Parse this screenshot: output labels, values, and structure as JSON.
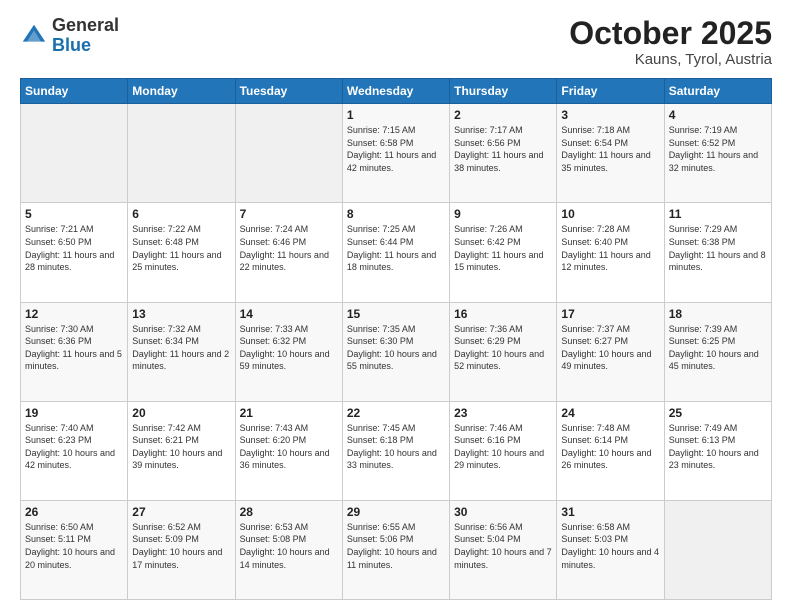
{
  "header": {
    "logo_general": "General",
    "logo_blue": "Blue",
    "month": "October 2025",
    "location": "Kauns, Tyrol, Austria"
  },
  "weekdays": [
    "Sunday",
    "Monday",
    "Tuesday",
    "Wednesday",
    "Thursday",
    "Friday",
    "Saturday"
  ],
  "weeks": [
    [
      {
        "day": "",
        "info": ""
      },
      {
        "day": "",
        "info": ""
      },
      {
        "day": "",
        "info": ""
      },
      {
        "day": "1",
        "info": "Sunrise: 7:15 AM\nSunset: 6:58 PM\nDaylight: 11 hours and 42 minutes."
      },
      {
        "day": "2",
        "info": "Sunrise: 7:17 AM\nSunset: 6:56 PM\nDaylight: 11 hours and 38 minutes."
      },
      {
        "day": "3",
        "info": "Sunrise: 7:18 AM\nSunset: 6:54 PM\nDaylight: 11 hours and 35 minutes."
      },
      {
        "day": "4",
        "info": "Sunrise: 7:19 AM\nSunset: 6:52 PM\nDaylight: 11 hours and 32 minutes."
      }
    ],
    [
      {
        "day": "5",
        "info": "Sunrise: 7:21 AM\nSunset: 6:50 PM\nDaylight: 11 hours and 28 minutes."
      },
      {
        "day": "6",
        "info": "Sunrise: 7:22 AM\nSunset: 6:48 PM\nDaylight: 11 hours and 25 minutes."
      },
      {
        "day": "7",
        "info": "Sunrise: 7:24 AM\nSunset: 6:46 PM\nDaylight: 11 hours and 22 minutes."
      },
      {
        "day": "8",
        "info": "Sunrise: 7:25 AM\nSunset: 6:44 PM\nDaylight: 11 hours and 18 minutes."
      },
      {
        "day": "9",
        "info": "Sunrise: 7:26 AM\nSunset: 6:42 PM\nDaylight: 11 hours and 15 minutes."
      },
      {
        "day": "10",
        "info": "Sunrise: 7:28 AM\nSunset: 6:40 PM\nDaylight: 11 hours and 12 minutes."
      },
      {
        "day": "11",
        "info": "Sunrise: 7:29 AM\nSunset: 6:38 PM\nDaylight: 11 hours and 8 minutes."
      }
    ],
    [
      {
        "day": "12",
        "info": "Sunrise: 7:30 AM\nSunset: 6:36 PM\nDaylight: 11 hours and 5 minutes."
      },
      {
        "day": "13",
        "info": "Sunrise: 7:32 AM\nSunset: 6:34 PM\nDaylight: 11 hours and 2 minutes."
      },
      {
        "day": "14",
        "info": "Sunrise: 7:33 AM\nSunset: 6:32 PM\nDaylight: 10 hours and 59 minutes."
      },
      {
        "day": "15",
        "info": "Sunrise: 7:35 AM\nSunset: 6:30 PM\nDaylight: 10 hours and 55 minutes."
      },
      {
        "day": "16",
        "info": "Sunrise: 7:36 AM\nSunset: 6:29 PM\nDaylight: 10 hours and 52 minutes."
      },
      {
        "day": "17",
        "info": "Sunrise: 7:37 AM\nSunset: 6:27 PM\nDaylight: 10 hours and 49 minutes."
      },
      {
        "day": "18",
        "info": "Sunrise: 7:39 AM\nSunset: 6:25 PM\nDaylight: 10 hours and 45 minutes."
      }
    ],
    [
      {
        "day": "19",
        "info": "Sunrise: 7:40 AM\nSunset: 6:23 PM\nDaylight: 10 hours and 42 minutes."
      },
      {
        "day": "20",
        "info": "Sunrise: 7:42 AM\nSunset: 6:21 PM\nDaylight: 10 hours and 39 minutes."
      },
      {
        "day": "21",
        "info": "Sunrise: 7:43 AM\nSunset: 6:20 PM\nDaylight: 10 hours and 36 minutes."
      },
      {
        "day": "22",
        "info": "Sunrise: 7:45 AM\nSunset: 6:18 PM\nDaylight: 10 hours and 33 minutes."
      },
      {
        "day": "23",
        "info": "Sunrise: 7:46 AM\nSunset: 6:16 PM\nDaylight: 10 hours and 29 minutes."
      },
      {
        "day": "24",
        "info": "Sunrise: 7:48 AM\nSunset: 6:14 PM\nDaylight: 10 hours and 26 minutes."
      },
      {
        "day": "25",
        "info": "Sunrise: 7:49 AM\nSunset: 6:13 PM\nDaylight: 10 hours and 23 minutes."
      }
    ],
    [
      {
        "day": "26",
        "info": "Sunrise: 6:50 AM\nSunset: 5:11 PM\nDaylight: 10 hours and 20 minutes."
      },
      {
        "day": "27",
        "info": "Sunrise: 6:52 AM\nSunset: 5:09 PM\nDaylight: 10 hours and 17 minutes."
      },
      {
        "day": "28",
        "info": "Sunrise: 6:53 AM\nSunset: 5:08 PM\nDaylight: 10 hours and 14 minutes."
      },
      {
        "day": "29",
        "info": "Sunrise: 6:55 AM\nSunset: 5:06 PM\nDaylight: 10 hours and 11 minutes."
      },
      {
        "day": "30",
        "info": "Sunrise: 6:56 AM\nSunset: 5:04 PM\nDaylight: 10 hours and 7 minutes."
      },
      {
        "day": "31",
        "info": "Sunrise: 6:58 AM\nSunset: 5:03 PM\nDaylight: 10 hours and 4 minutes."
      },
      {
        "day": "",
        "info": ""
      }
    ]
  ]
}
